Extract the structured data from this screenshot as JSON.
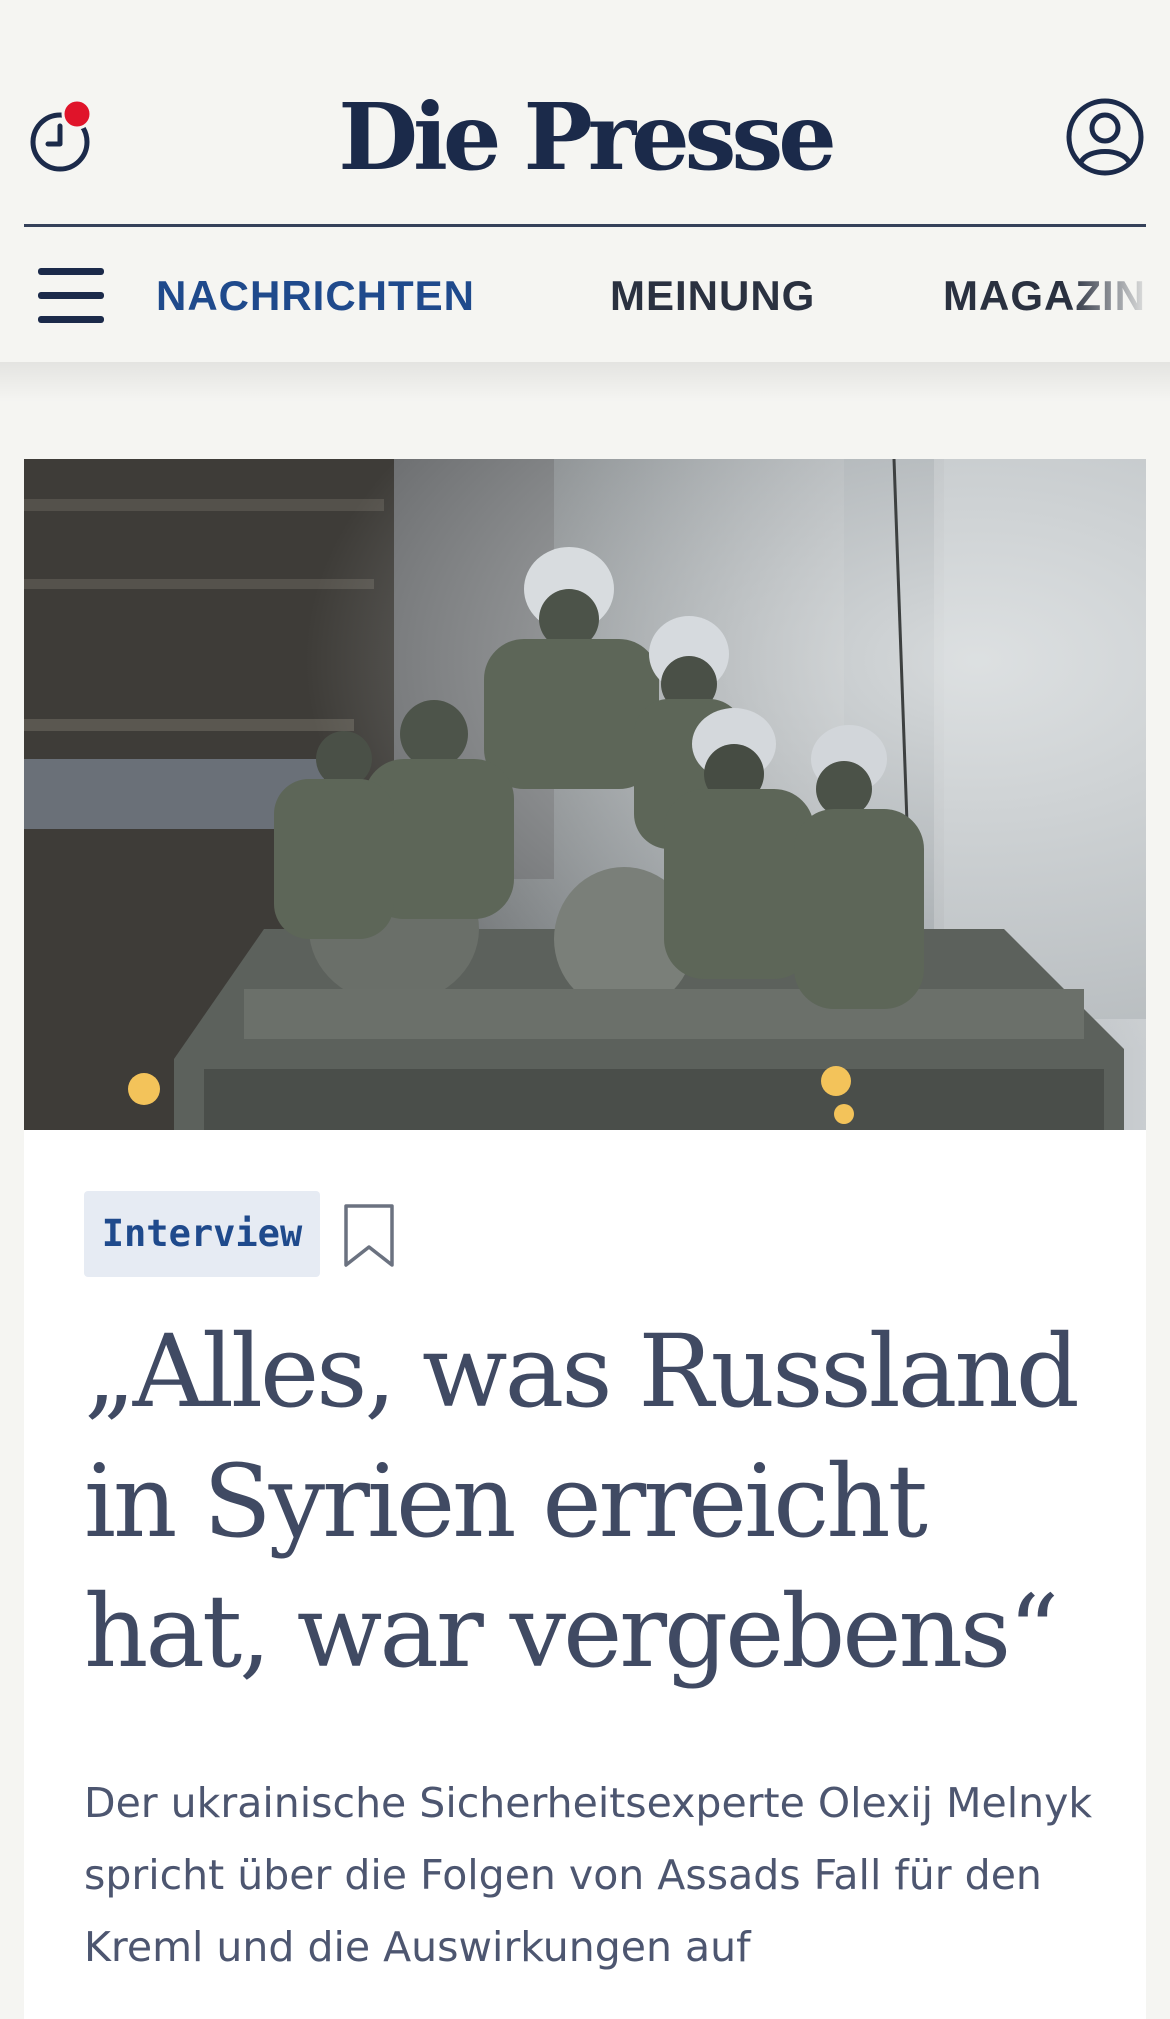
{
  "header": {
    "logo": "Die Presse",
    "history_icon": "clock-icon",
    "notification_dot_color": "#e0142a",
    "account_icon": "user-icon"
  },
  "nav": {
    "menu_icon": "hamburger-icon",
    "items": [
      {
        "label": "NACHRICHTEN",
        "active": true
      },
      {
        "label": "MEINUNG",
        "active": false
      },
      {
        "label": "MAGAZIN",
        "active": false
      }
    ]
  },
  "article": {
    "image_description_icon": "hero-photo",
    "tag": "Interview",
    "bookmark_icon": "bookmark-icon",
    "headline": "„Alles, was Russland in Syrien erreicht hat, war vergebens“",
    "lead": "Der ukrainische Sicherheitsexperte Olexij Melnyk spricht über die Folgen von Assads Fall für den Kreml und die Auswirkungen auf"
  },
  "colors": {
    "brand": "#1b2a4a",
    "accent": "#1f4a8c",
    "background": "#f5f5f2",
    "tag_background": "#e6ebf3"
  }
}
